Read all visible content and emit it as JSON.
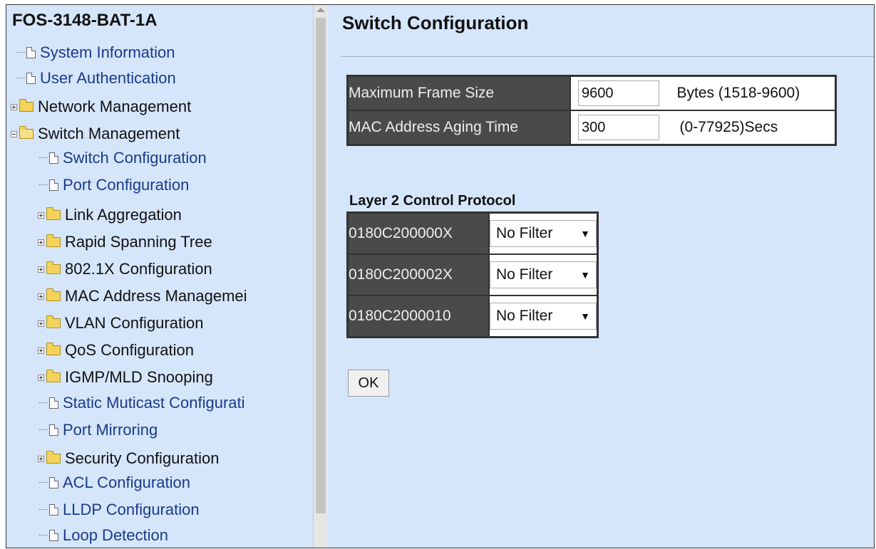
{
  "sidebar": {
    "device_title": "FOS-3148-BAT-1A",
    "items": [
      {
        "label": "System Information"
      },
      {
        "label": "User Authentication"
      },
      {
        "label": "Network Management"
      },
      {
        "label": "Switch Management"
      },
      {
        "label": "Switch Configuration"
      },
      {
        "label": "Port Configuration"
      },
      {
        "label": "Link Aggregation"
      },
      {
        "label": "Rapid Spanning Tree"
      },
      {
        "label": "802.1X Configuration"
      },
      {
        "label": "MAC Address Managemei"
      },
      {
        "label": "VLAN Configuration"
      },
      {
        "label": "QoS Configuration"
      },
      {
        "label": "IGMP/MLD Snooping"
      },
      {
        "label": "Static Muticast Configurati"
      },
      {
        "label": "Port Mirroring"
      },
      {
        "label": "Security Configuration"
      },
      {
        "label": "ACL Configuration"
      },
      {
        "label": "LLDP Configuration"
      },
      {
        "label": "Loop Detection"
      }
    ]
  },
  "main": {
    "page_title": "Switch Configuration",
    "settings": {
      "max_frame_label": "Maximum Frame Size",
      "max_frame_value": "9600",
      "max_frame_unit": "Bytes (1518-9600)",
      "aging_label": "MAC Address Aging Time",
      "aging_value": "300",
      "aging_unit": "(0-77925)Secs"
    },
    "l2cp": {
      "title": "Layer 2 Control Protocol",
      "rows": [
        {
          "address": "0180C200000X",
          "selected": "No Filter"
        },
        {
          "address": "0180C200002X",
          "selected": "No Filter"
        },
        {
          "address": "0180C2000010",
          "selected": "No Filter"
        }
      ]
    },
    "ok_label": "OK"
  }
}
